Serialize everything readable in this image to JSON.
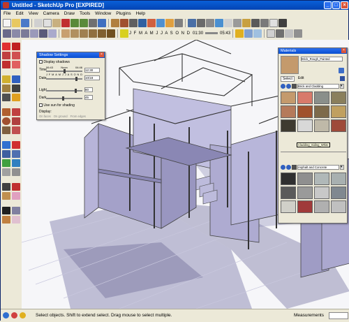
{
  "window": {
    "title": "Untitled - SketchUp Pro [EXPIRED]"
  },
  "menu": [
    "File",
    "Edit",
    "View",
    "Camera",
    "Draw",
    "Tools",
    "Window",
    "Plugins",
    "Help"
  ],
  "toolbar_row2": {
    "time_left": "01:30",
    "time_right": "05:43"
  },
  "shadow_settings": {
    "title": "Shadow Settings",
    "display_shadows": "Display shadows",
    "time_label": "Time",
    "time_value": "12:30",
    "time_marks": [
      "06:43",
      "Noon",
      "04:46"
    ],
    "date_label": "Date",
    "date_value": "10/18",
    "light_label": "Light",
    "light_value": "80",
    "dark_label": "Dark",
    "dark_value": "45",
    "sun_shading": "Use sun for shading",
    "display_label": "Display:",
    "on_faces": "On faces",
    "on_ground": "On ground",
    "from_edges": "From edges",
    "months": [
      "J",
      "F",
      "M",
      "A",
      "M",
      "J",
      "J",
      "A",
      "S",
      "O",
      "N",
      "D"
    ]
  },
  "materials": {
    "title": "Materials",
    "current_material": "Brick_Rough_Painted",
    "tab_select": "Select",
    "tab_edit": "Edit",
    "collection_top": "Brick and Cladding",
    "tooltip": "Cladding_Siding_White",
    "collection_bottom": "Asphalt and Concrete",
    "colors": {
      "top": [
        "#c49a6c",
        "#d87a6a",
        "#8a8f8a",
        "#8a7f5c",
        "#b57a5a",
        "#a0522d",
        "#7d6a4a",
        "#c0a060",
        "#3e3a30",
        "#d8d8d8",
        "#bfb9a8",
        "#9e4a3a"
      ],
      "bottom": [
        "#303030",
        "#8f8f8f",
        "#b0b8b8",
        "#a8b0b0",
        "#5a5a5a",
        "#9a9a9a",
        "#c8c8c8",
        "#808890",
        "#d0d0c8",
        "#a03a3a",
        "#b0b0b0",
        "#c0c0c0"
      ]
    }
  },
  "status": {
    "message": "Select objects. Shift to extend select. Drag mouse to select multiple.",
    "measurements_label": "Measurements"
  }
}
